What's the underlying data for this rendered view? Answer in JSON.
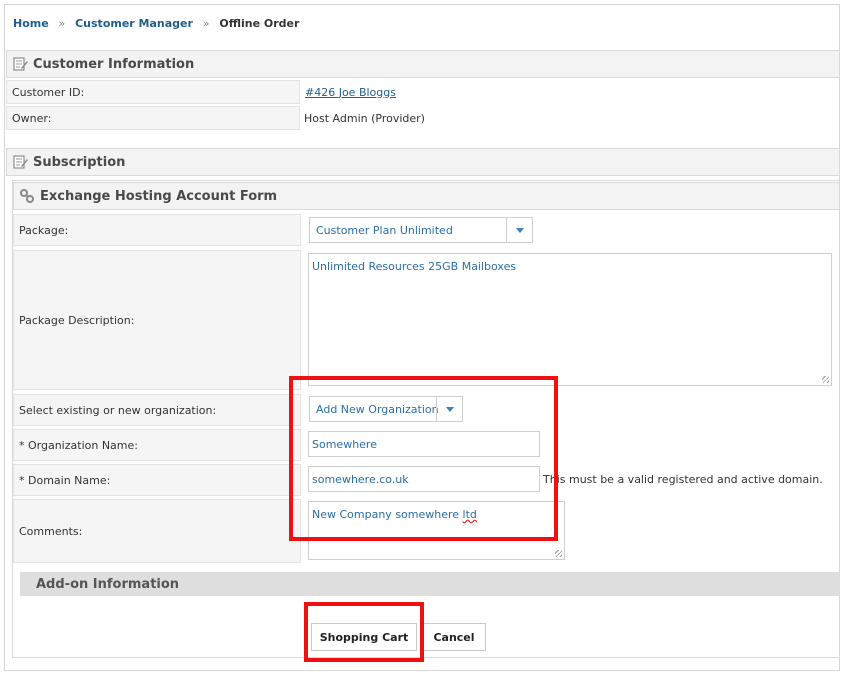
{
  "breadcrumb": {
    "home": "Home",
    "customer_manager": "Customer Manager",
    "current": "Offline Order",
    "separator": "»"
  },
  "customer_info": {
    "title": "Customer Information",
    "rows": [
      {
        "label": "Customer ID:",
        "value": "#426 Joe Bloggs"
      },
      {
        "label": "Owner:",
        "value": "Host Admin (Provider)"
      }
    ]
  },
  "subscription": {
    "title": "Subscription"
  },
  "form": {
    "title": "Exchange Hosting Account Form",
    "package_label": "Package:",
    "package_value": "Customer Plan Unlimited",
    "description_label": "Package Description:",
    "description_value": "Unlimited Resources 25GB Mailboxes",
    "org_select_label": "Select existing or new organization:",
    "org_select_value": "Add New Organization",
    "org_name_label": "* Organization Name:",
    "org_name_value": "Somewhere",
    "domain_label": "* Domain Name:",
    "domain_value": "somewhere.co.uk",
    "domain_hint": "This must be a valid registered and active domain.",
    "comments_label": "Comments:",
    "comments_value_main": "New Company somewhere ",
    "comments_value_misspelled": "ltd"
  },
  "addon": {
    "title": "Add-on Information"
  },
  "buttons": {
    "shopping_cart": "Shopping Cart",
    "cancel": "Cancel"
  },
  "colors": {
    "highlight": "#ee1111",
    "link": "#1f5e8a",
    "input_text": "#2b6ea6"
  }
}
